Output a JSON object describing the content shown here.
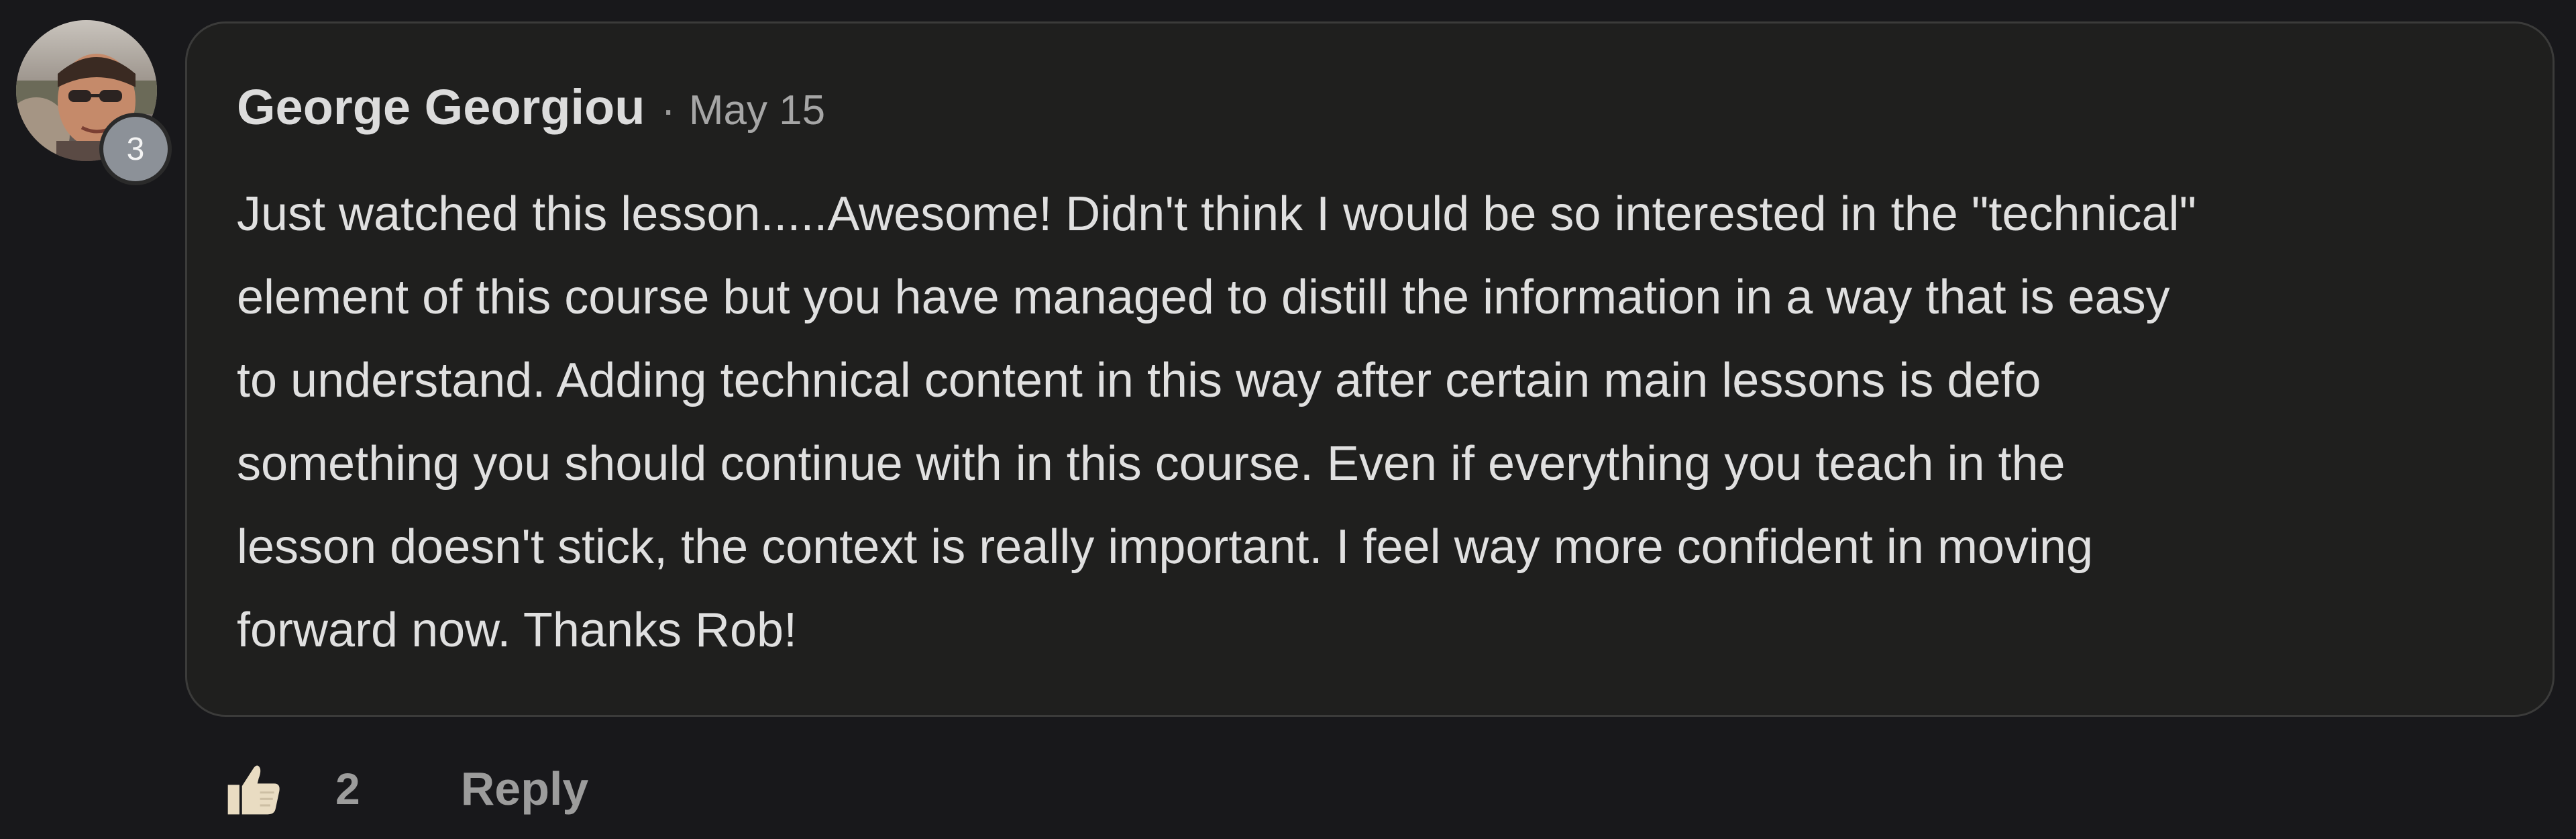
{
  "comment": {
    "author": "George Georgiou",
    "separator": "·",
    "date": "May 15",
    "author_level": "3",
    "body_lines": [
      "Just watched this lesson.....Awesome! Didn't think I would be so interested in the \"technical\"",
      "element of this course but you have managed to distill the information in a way that is easy",
      "to understand. Adding technical content in this way after certain main lessons is defo",
      "something you should continue with in this course. Even if everything you teach in the",
      "lesson doesn't stick, the context is really important. I feel way more confident in moving",
      "forward now. Thanks Rob!"
    ],
    "actions": {
      "like_icon": "thumbs-up-icon",
      "like_count": "2",
      "reply_label": "Reply"
    }
  },
  "colors": {
    "page_background": "#18181b",
    "bubble_background": "#1f1f1e",
    "bubble_border": "#3b3b3a",
    "badge_background": "#8c9198",
    "like_icon_color": "#e9dcc2"
  }
}
